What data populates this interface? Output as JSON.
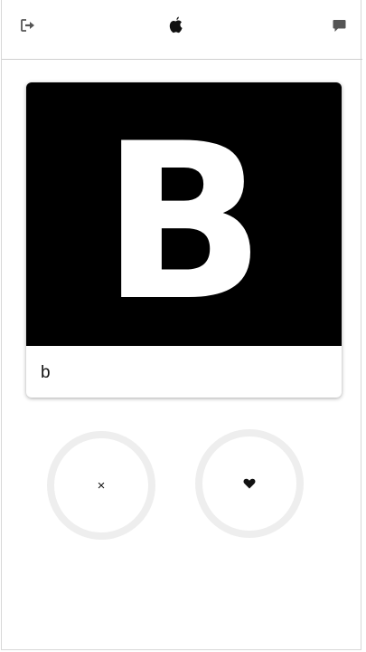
{
  "header": {
    "logout_icon": "logout-icon",
    "logo_icon": "apple-logo-icon",
    "chat_icon": "chat-bubble-icon"
  },
  "card": {
    "image_letter": "B",
    "label": "b"
  },
  "actions": {
    "dislike_glyph": "×",
    "dislike_icon": "close-icon",
    "like_icon": "heart-icon"
  },
  "colors": {
    "image_bg": "#000000",
    "ring": "#eeeeee",
    "icon": "#555555"
  }
}
